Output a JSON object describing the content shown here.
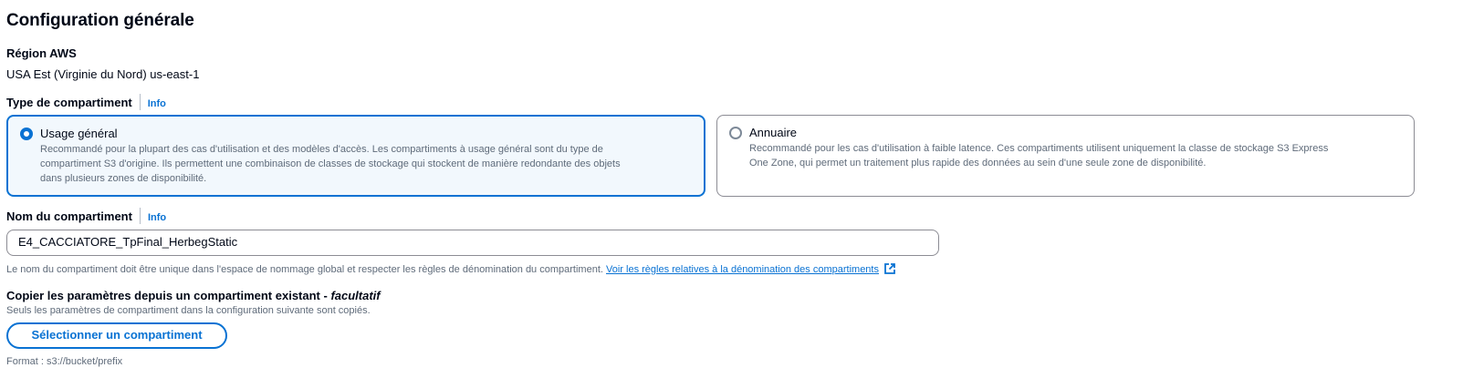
{
  "section": {
    "title": "Configuration générale"
  },
  "region": {
    "label": "Région AWS",
    "value": "USA Est (Virginie du Nord) us-east-1"
  },
  "bucket_type": {
    "label": "Type de compartiment",
    "info": "Info",
    "options": [
      {
        "title": "Usage général",
        "desc_1": "Recommandé pour la plupart des cas d'utilisation et des modèles d'accès. Les compartiments à usage général sont du type de",
        "desc_2": "compartiment S3 d'origine. Ils permettent une combinaison de classes de stockage qui stockent de manière redondante des objets",
        "desc_3": "dans plusieurs zones de disponibilité.",
        "selected": true
      },
      {
        "title": "Annuaire",
        "desc_1": "Recommandé pour les cas d'utilisation à faible latence. Ces compartiments utilisent uniquement la classe de stockage S3 Express",
        "desc_2": "One Zone, qui permet un traitement plus rapide des données au sein d'une seule zone de disponibilité.",
        "selected": false
      }
    ]
  },
  "bucket_name": {
    "label": "Nom du compartiment",
    "info": "Info",
    "value": "E4_CACCIATORE_TpFinal_HerbegStatic",
    "hint": "Le nom du compartiment doit être unique dans l'espace de nommage global et respecter les règles de dénomination du compartiment.",
    "link": "Voir les règles relatives à la dénomination des compartiments",
    "link_icon": "external-link-icon"
  },
  "copy_settings": {
    "label": "Copier les paramètres depuis un compartiment existant - ",
    "label_optional": "facultatif",
    "desc": "Seuls les paramètres de compartiment dans la configuration suivante sont copiés.",
    "button": "Sélectionner un compartiment",
    "format": "Format : s3://bucket/prefix"
  },
  "colors": {
    "accent": "#0972d3",
    "selected_bg": "#f2f8fd",
    "text": "#000716",
    "muted": "#5f6b7a"
  }
}
